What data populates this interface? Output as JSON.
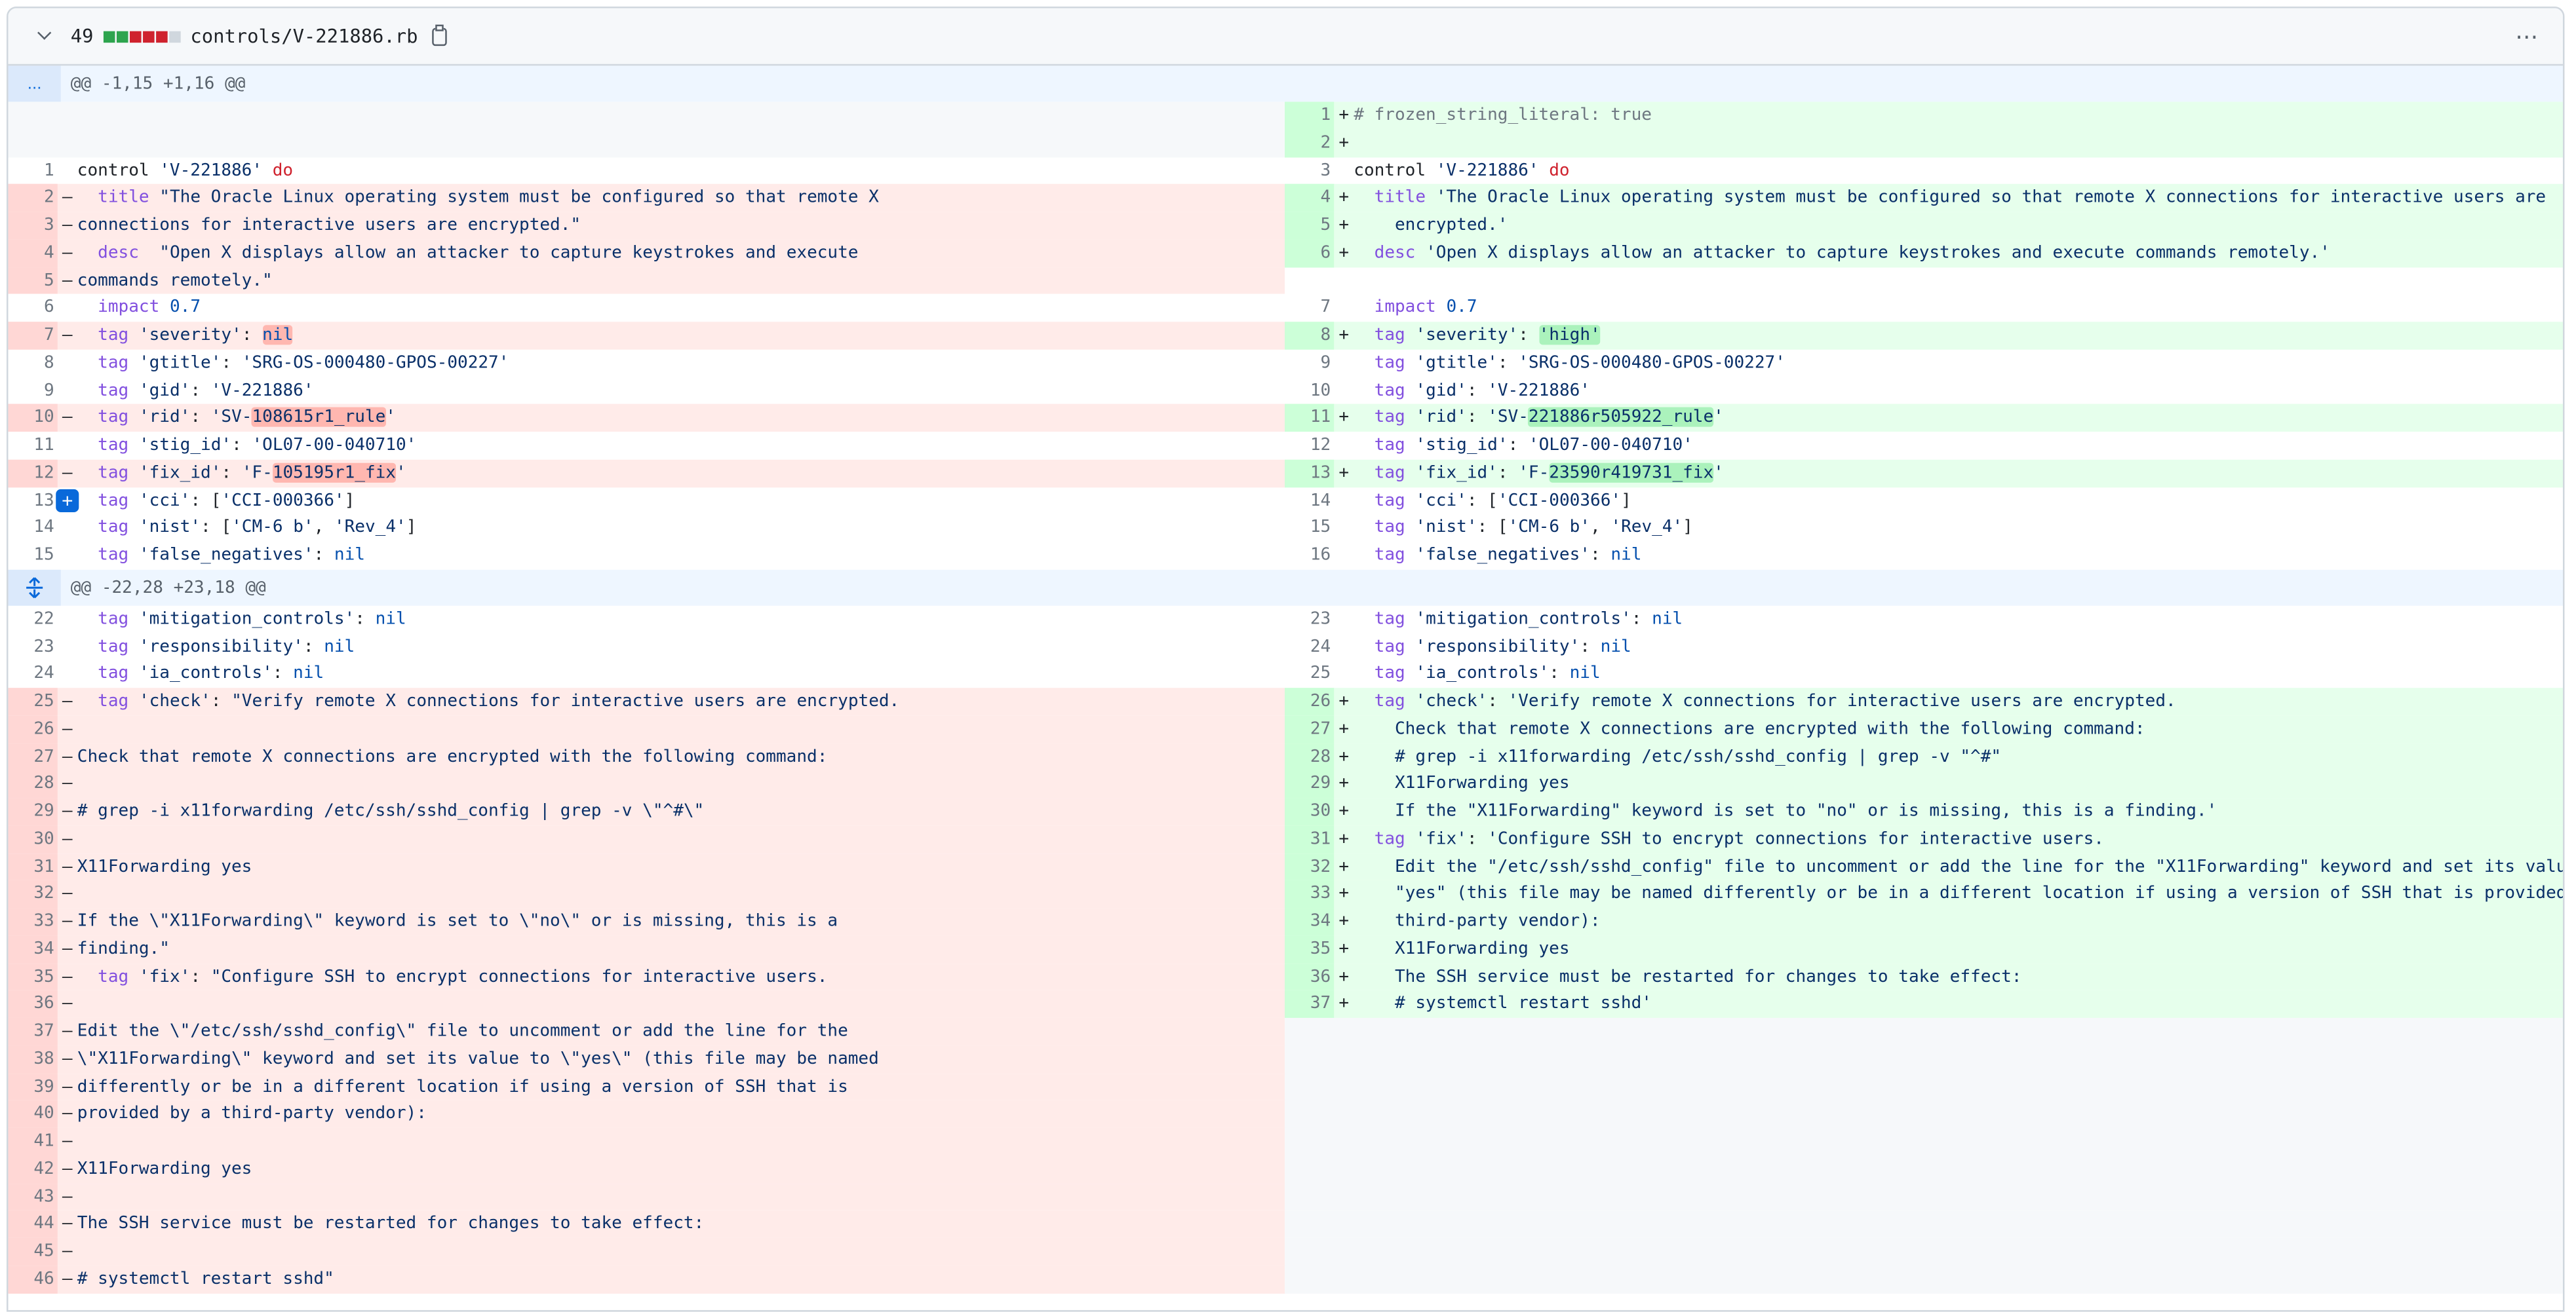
{
  "file": {
    "changes": "49",
    "name": "controls/V-221886.rb",
    "diffstat": [
      "add",
      "add",
      "del",
      "del",
      "del",
      "neutral"
    ],
    "menu_icon": "kebab-horizontal-icon"
  },
  "hunks": [
    {
      "header": "@@ -1,15 +1,16 @@",
      "expander": "...",
      "rows": [
        {
          "l": {
            "t": "blank"
          },
          "r": {
            "t": "add",
            "n": "1",
            "h": "<span class=\"cmt\"># frozen_string_literal: true</span>"
          }
        },
        {
          "l": {
            "t": "blank"
          },
          "r": {
            "t": "add",
            "n": "2",
            "h": ""
          }
        },
        {
          "l": {
            "t": "ctx",
            "n": "1",
            "h": "control <span class=\"str\">'V-221886'</span> <span class=\"kw\">do</span>"
          },
          "r": {
            "t": "ctx",
            "n": "3",
            "h": "control <span class=\"str\">'V-221886'</span> <span class=\"kw\">do</span>"
          }
        },
        {
          "l": {
            "t": "del",
            "n": "2",
            "h": "  <span class=\"fn\">title</span> <span class=\"str\">\"The Oracle Linux operating system must be configured so that remote X</span>"
          },
          "r": {
            "t": "add",
            "n": "4",
            "h": "  <span class=\"fn\">title</span> <span class=\"str\">'The Oracle Linux operating system must be configured so that remote X connections for interactive users are</span>"
          }
        },
        {
          "l": {
            "t": "del",
            "n": "3",
            "h": "<span class=\"str\">connections for interactive users are encrypted.\"</span>"
          },
          "r": {
            "t": "add",
            "n": "5",
            "h": "<span class=\"str\">    encrypted.'</span>"
          }
        },
        {
          "l": {
            "t": "del",
            "n": "4",
            "h": "  <span class=\"fn\">desc</span>  <span class=\"str\">\"Open X displays allow an attacker to capture keystrokes and execute</span>"
          },
          "r": {
            "t": "add",
            "n": "6",
            "h": "  <span class=\"fn\">desc</span> <span class=\"str\">'Open X displays allow an attacker to capture keystrokes and execute commands remotely.'</span>"
          }
        },
        {
          "l": {
            "t": "del",
            "n": "5",
            "h": "<span class=\"str\">commands remotely.\"</span>"
          },
          "r": {
            "t": "empty"
          }
        },
        {
          "l": {
            "t": "ctx",
            "n": "6",
            "h": "  <span class=\"fn\">impact</span> <span class=\"num\">0.7</span>"
          },
          "r": {
            "t": "ctx",
            "n": "7",
            "h": "  <span class=\"fn\">impact</span> <span class=\"num\">0.7</span>"
          }
        },
        {
          "l": {
            "t": "del",
            "n": "7",
            "h": "  <span class=\"fn\">tag</span> <span class=\"str\">'severity'</span>: <span class=\"nil hdel\">nil</span>"
          },
          "r": {
            "t": "add",
            "n": "8",
            "h": "  <span class=\"fn\">tag</span> <span class=\"str\">'severity'</span>: <span class=\"str hadd\">'high'</span>"
          }
        },
        {
          "l": {
            "t": "ctx",
            "n": "8",
            "h": "  <span class=\"fn\">tag</span> <span class=\"str\">'gtitle'</span>: <span class=\"str\">'SRG-OS-000480-GPOS-00227'</span>"
          },
          "r": {
            "t": "ctx",
            "n": "9",
            "h": "  <span class=\"fn\">tag</span> <span class=\"str\">'gtitle'</span>: <span class=\"str\">'SRG-OS-000480-GPOS-00227'</span>"
          }
        },
        {
          "l": {
            "t": "ctx",
            "n": "9",
            "h": "  <span class=\"fn\">tag</span> <span class=\"str\">'gid'</span>: <span class=\"str\">'V-221886'</span>"
          },
          "r": {
            "t": "ctx",
            "n": "10",
            "h": "  <span class=\"fn\">tag</span> <span class=\"str\">'gid'</span>: <span class=\"str\">'V-221886'</span>"
          }
        },
        {
          "l": {
            "t": "del",
            "n": "10",
            "h": "  <span class=\"fn\">tag</span> <span class=\"str\">'rid'</span>: <span class=\"str\">'SV-<span class=\"hdel\">108615r1_rule</span>'</span>"
          },
          "r": {
            "t": "add",
            "n": "11",
            "h": "  <span class=\"fn\">tag</span> <span class=\"str\">'rid'</span>: <span class=\"str\">'SV-<span class=\"hadd\">221886r505922_rule</span>'</span>"
          }
        },
        {
          "l": {
            "t": "ctx",
            "n": "11",
            "h": "  <span class=\"fn\">tag</span> <span class=\"str\">'stig_id'</span>: <span class=\"str\">'OL07-00-040710'</span>"
          },
          "r": {
            "t": "ctx",
            "n": "12",
            "h": "  <span class=\"fn\">tag</span> <span class=\"str\">'stig_id'</span>: <span class=\"str\">'OL07-00-040710'</span>"
          }
        },
        {
          "l": {
            "t": "del",
            "n": "12",
            "h": "  <span class=\"fn\">tag</span> <span class=\"str\">'fix_id'</span>: <span class=\"str\">'F-<span class=\"hdel\">105195r1_fix</span>'</span>"
          },
          "r": {
            "t": "add",
            "n": "13",
            "h": "  <span class=\"fn\">tag</span> <span class=\"str\">'fix_id'</span>: <span class=\"str\">'F-<span class=\"hadd\">23590r419731_fix</span>'</span>"
          }
        },
        {
          "l": {
            "t": "ctx",
            "n": "13",
            "h": "  <span class=\"fn\">tag</span> <span class=\"str\">'cci'</span>: [<span class=\"str\">'CCI-000366'</span>]",
            "plus": true
          },
          "r": {
            "t": "ctx",
            "n": "14",
            "h": "  <span class=\"fn\">tag</span> <span class=\"str\">'cci'</span>: [<span class=\"str\">'CCI-000366'</span>]"
          }
        },
        {
          "l": {
            "t": "ctx",
            "n": "14",
            "h": "  <span class=\"fn\">tag</span> <span class=\"str\">'nist'</span>: [<span class=\"str\">'CM-6 b'</span>, <span class=\"str\">'Rev_4'</span>]"
          },
          "r": {
            "t": "ctx",
            "n": "15",
            "h": "  <span class=\"fn\">tag</span> <span class=\"str\">'nist'</span>: [<span class=\"str\">'CM-6 b'</span>, <span class=\"str\">'Rev_4'</span>]"
          }
        },
        {
          "l": {
            "t": "ctx",
            "n": "15",
            "h": "  <span class=\"fn\">tag</span> <span class=\"str\">'false_negatives'</span>: <span class=\"nil\">nil</span>"
          },
          "r": {
            "t": "ctx",
            "n": "16",
            "h": "  <span class=\"fn\">tag</span> <span class=\"str\">'false_negatives'</span>: <span class=\"nil\">nil</span>"
          }
        }
      ]
    },
    {
      "header": "@@ -22,28 +23,18 @@",
      "expander": "expand-icon",
      "rows": [
        {
          "l": {
            "t": "ctx",
            "n": "22",
            "h": "  <span class=\"fn\">tag</span> <span class=\"str\">'mitigation_controls'</span>: <span class=\"nil\">nil</span>"
          },
          "r": {
            "t": "ctx",
            "n": "23",
            "h": "  <span class=\"fn\">tag</span> <span class=\"str\">'mitigation_controls'</span>: <span class=\"nil\">nil</span>"
          }
        },
        {
          "l": {
            "t": "ctx",
            "n": "23",
            "h": "  <span class=\"fn\">tag</span> <span class=\"str\">'responsibility'</span>: <span class=\"nil\">nil</span>"
          },
          "r": {
            "t": "ctx",
            "n": "24",
            "h": "  <span class=\"fn\">tag</span> <span class=\"str\">'responsibility'</span>: <span class=\"nil\">nil</span>"
          }
        },
        {
          "l": {
            "t": "ctx",
            "n": "24",
            "h": "  <span class=\"fn\">tag</span> <span class=\"str\">'ia_controls'</span>: <span class=\"nil\">nil</span>"
          },
          "r": {
            "t": "ctx",
            "n": "25",
            "h": "  <span class=\"fn\">tag</span> <span class=\"str\">'ia_controls'</span>: <span class=\"nil\">nil</span>"
          }
        },
        {
          "l": {
            "t": "del",
            "n": "25",
            "h": "  <span class=\"fn\">tag</span> <span class=\"str\">'check'</span>: <span class=\"str\">\"Verify remote X connections for interactive users are encrypted.</span>"
          },
          "r": {
            "t": "add",
            "n": "26",
            "h": "  <span class=\"fn\">tag</span> <span class=\"str\">'check'</span>: <span class=\"str\">'Verify remote X connections for interactive users are encrypted.</span>"
          }
        },
        {
          "l": {
            "t": "del",
            "n": "26",
            "h": ""
          },
          "r": {
            "t": "add",
            "n": "27",
            "h": "<span class=\"str\">    Check that remote X connections are encrypted with the following command:</span>"
          }
        },
        {
          "l": {
            "t": "del",
            "n": "27",
            "h": "<span class=\"str\">Check that remote X connections are encrypted with the following command:</span>"
          },
          "r": {
            "t": "add",
            "n": "28",
            "h": "<span class=\"str\">    # grep -i x11forwarding /etc/ssh/sshd_config | grep -v \"^#\"</span>"
          }
        },
        {
          "l": {
            "t": "del",
            "n": "28",
            "h": ""
          },
          "r": {
            "t": "add",
            "n": "29",
            "h": "<span class=\"str\">    X11Forwarding yes</span>"
          }
        },
        {
          "l": {
            "t": "del",
            "n": "29",
            "h": "<span class=\"str\"># grep -i x11forwarding /etc/ssh/sshd_config | grep -v \\\"^#\\\"</span>"
          },
          "r": {
            "t": "add",
            "n": "30",
            "h": "<span class=\"str\">    If the \"X11Forwarding\" keyword is set to \"no\" or is missing, this is a finding.'</span>"
          }
        },
        {
          "l": {
            "t": "del",
            "n": "30",
            "h": ""
          },
          "r": {
            "t": "add",
            "n": "31",
            "h": "  <span class=\"fn\">tag</span> <span class=\"str\">'fix'</span>: <span class=\"str\">'Configure SSH to encrypt connections for interactive users.</span>"
          }
        },
        {
          "l": {
            "t": "del",
            "n": "31",
            "h": "<span class=\"str\">X11Forwarding yes</span>"
          },
          "r": {
            "t": "add",
            "n": "32",
            "h": "<span class=\"str\">    Edit the \"/etc/ssh/sshd_config\" file to uncomment or add the line for the \"X11Forwarding\" keyword and set its value to</span>"
          }
        },
        {
          "l": {
            "t": "del",
            "n": "32",
            "h": ""
          },
          "r": {
            "t": "add",
            "n": "33",
            "h": "<span class=\"str\">    \"yes\" (this file may be named differently or be in a different location if using a version of SSH that is provided by a</span>"
          }
        },
        {
          "l": {
            "t": "del",
            "n": "33",
            "h": "<span class=\"str\">If the \\\"X11Forwarding\\\" keyword is set to \\\"no\\\" or is missing, this is a</span>"
          },
          "r": {
            "t": "add",
            "n": "34",
            "h": "<span class=\"str\">    third-party vendor):</span>"
          }
        },
        {
          "l": {
            "t": "del",
            "n": "34",
            "h": "<span class=\"str\">finding.\"</span>"
          },
          "r": {
            "t": "add",
            "n": "35",
            "h": "<span class=\"str\">    X11Forwarding yes</span>"
          }
        },
        {
          "l": {
            "t": "del",
            "n": "35",
            "h": "  <span class=\"fn\">tag</span> <span class=\"str\">'fix'</span>: <span class=\"str\">\"Configure SSH to encrypt connections for interactive users.</span>"
          },
          "r": {
            "t": "add",
            "n": "36",
            "h": "<span class=\"str\">    The SSH service must be restarted for changes to take effect:</span>"
          }
        },
        {
          "l": {
            "t": "del",
            "n": "36",
            "h": ""
          },
          "r": {
            "t": "add",
            "n": "37",
            "h": "<span class=\"str\">    # systemctl restart sshd'</span>"
          }
        },
        {
          "l": {
            "t": "del",
            "n": "37",
            "h": "<span class=\"str\">Edit the \\\"/etc/ssh/sshd_config\\\" file to uncomment or add the line for the</span>"
          },
          "r": {
            "t": "blank"
          }
        },
        {
          "l": {
            "t": "del",
            "n": "38",
            "h": "<span class=\"str\">\\\"X11Forwarding\\\" keyword and set its value to \\\"yes\\\" (this file may be named</span>"
          },
          "r": {
            "t": "blank"
          }
        },
        {
          "l": {
            "t": "del",
            "n": "39",
            "h": "<span class=\"str\">differently or be in a different location if using a version of SSH that is</span>"
          },
          "r": {
            "t": "blank"
          }
        },
        {
          "l": {
            "t": "del",
            "n": "40",
            "h": "<span class=\"str\">provided by a third-party vendor):</span>"
          },
          "r": {
            "t": "blank"
          }
        },
        {
          "l": {
            "t": "del",
            "n": "41",
            "h": ""
          },
          "r": {
            "t": "blank"
          }
        },
        {
          "l": {
            "t": "del",
            "n": "42",
            "h": "<span class=\"str\">X11Forwarding yes</span>"
          },
          "r": {
            "t": "blank"
          }
        },
        {
          "l": {
            "t": "del",
            "n": "43",
            "h": ""
          },
          "r": {
            "t": "blank"
          }
        },
        {
          "l": {
            "t": "del",
            "n": "44",
            "h": "<span class=\"str\">The SSH service must be restarted for changes to take effect:</span>"
          },
          "r": {
            "t": "blank"
          }
        },
        {
          "l": {
            "t": "del",
            "n": "45",
            "h": ""
          },
          "r": {
            "t": "blank"
          }
        },
        {
          "l": {
            "t": "del",
            "n": "46",
            "h": "<span class=\"str\"># systemctl restart sshd\"</span>"
          },
          "r": {
            "t": "blank"
          }
        }
      ]
    }
  ]
}
